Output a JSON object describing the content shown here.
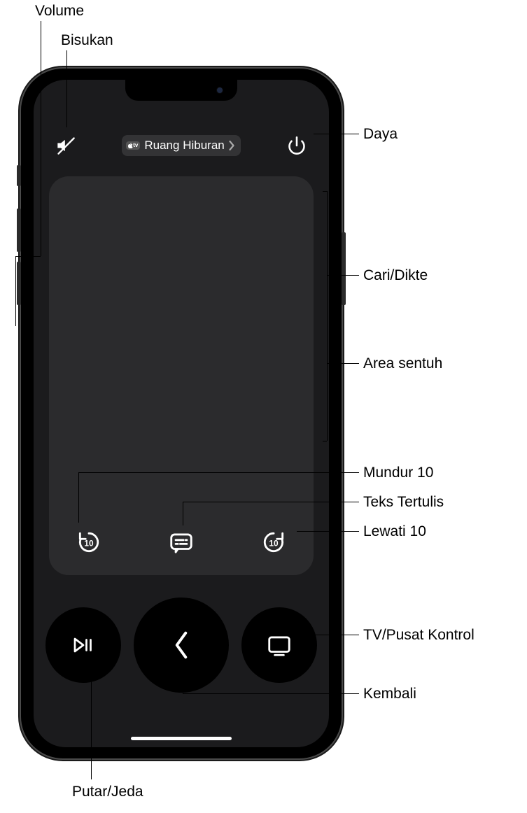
{
  "header": {
    "device_label": "Ruang Hiburan",
    "tv_badge_text": "tv"
  },
  "annotations": {
    "volume": "Volume",
    "mute": "Bisukan",
    "power": "Daya",
    "search_dictate": "Cari/Dikte",
    "touch_area": "Area sentuh",
    "rewind10": "Mundur 10",
    "captions": "Teks Tertulis",
    "skip10": "Lewati 10",
    "tv_control_center": "TV/Pusat Kontrol",
    "back": "Kembali",
    "play_pause": "Putar/Jeda"
  },
  "icons": {
    "mute": "mute-icon",
    "power": "power-icon",
    "chevron_right": "chevron-right-icon",
    "rewind10": "rewind-10-icon",
    "captions": "captions-icon",
    "forward10": "forward-10-icon",
    "play_pause": "play-pause-icon",
    "back": "back-chevron-icon",
    "tv": "tv-screen-icon",
    "apple": "apple-logo-icon"
  }
}
